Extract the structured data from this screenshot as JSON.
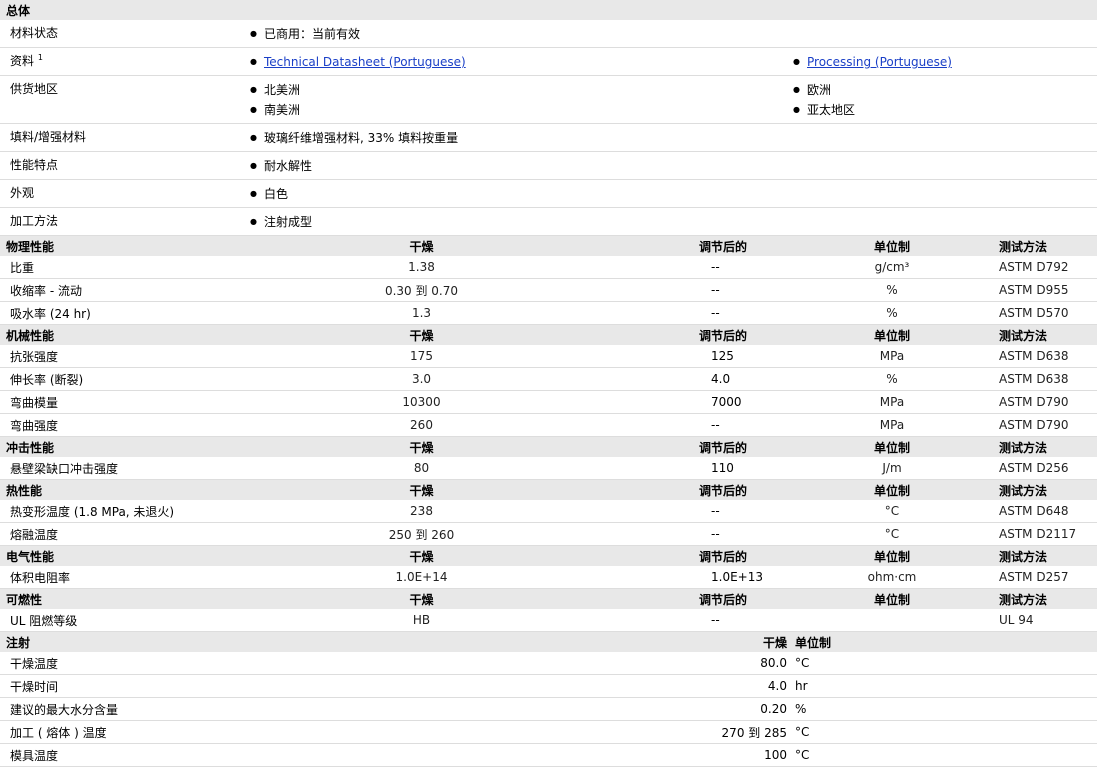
{
  "general": {
    "title": "总体",
    "rows": [
      {
        "label": "材料状态",
        "left": [
          "已商用：当前有效"
        ],
        "right": []
      },
      {
        "label": "资料",
        "sup": "1",
        "left_links": [
          "Technical Datasheet (Portuguese)"
        ],
        "right_links": [
          "Processing (Portuguese)"
        ]
      },
      {
        "label": "供货地区",
        "left": [
          "北美洲",
          "南美洲"
        ],
        "right": [
          "欧洲",
          "亚太地区"
        ]
      },
      {
        "label": "填料/增强材料",
        "left": [
          "玻璃纤维增强材料, 33% 填料按重量"
        ],
        "right": []
      },
      {
        "label": "性能特点",
        "left": [
          "耐水解性"
        ],
        "right": []
      },
      {
        "label": "外观",
        "left": [
          "白色"
        ],
        "right": []
      },
      {
        "label": "加工方法",
        "left": [
          "注射成型"
        ],
        "right": []
      }
    ]
  },
  "columns": {
    "dry": "干燥",
    "conditioned": "调节后的",
    "unit": "单位制",
    "method": "测试方法"
  },
  "sections": [
    {
      "title": "物理性能",
      "rows": [
        {
          "label": "比重",
          "dry": "1.38",
          "cond": "--",
          "unit": "g/cm³",
          "method": "ASTM D792"
        },
        {
          "label": "收缩率 - 流动",
          "dry": "0.30 到  0.70",
          "cond": "--",
          "unit": "%",
          "method": "ASTM D955"
        },
        {
          "label": "吸水率 (24 hr)",
          "dry": "1.3",
          "cond": "--",
          "unit": "%",
          "method": "ASTM D570"
        }
      ]
    },
    {
      "title": "机械性能",
      "rows": [
        {
          "label": "抗张强度",
          "dry": "175",
          "cond": "125",
          "unit": "MPa",
          "method": "ASTM D638"
        },
        {
          "label": "伸长率 (断裂)",
          "dry": "3.0",
          "cond": "4.0",
          "unit": "%",
          "method": "ASTM D638"
        },
        {
          "label": "弯曲模量",
          "dry": "10300",
          "cond": "7000",
          "unit": "MPa",
          "method": "ASTM D790"
        },
        {
          "label": "弯曲强度",
          "dry": "260",
          "cond": "--",
          "unit": "MPa",
          "method": "ASTM D790"
        }
      ]
    },
    {
      "title": "冲击性能",
      "rows": [
        {
          "label": "悬壁梁缺口冲击强度",
          "dry": "80",
          "cond": "110",
          "unit": "J/m",
          "method": "ASTM D256"
        }
      ]
    },
    {
      "title": "热性能",
      "rows": [
        {
          "label": "热变形温度 (1.8 MPa, 未退火)",
          "dry": "238",
          "cond": "--",
          "unit": "°C",
          "method": "ASTM D648"
        },
        {
          "label": "熔融温度",
          "dry": "250 到  260",
          "cond": "--",
          "unit": "°C",
          "method": "ASTM D2117"
        }
      ]
    },
    {
      "title": "电气性能",
      "rows": [
        {
          "label": "体积电阻率",
          "dry": "1.0E+14",
          "cond": "1.0E+13",
          "unit": "ohm·cm",
          "method": "ASTM D257"
        }
      ]
    },
    {
      "title": "可燃性",
      "rows": [
        {
          "label": "UL 阻燃等级",
          "dry": "HB",
          "cond": "--",
          "unit": "",
          "method": "UL 94"
        }
      ]
    }
  ],
  "injection": {
    "title": "注射",
    "col_dry": "干燥",
    "col_unit": "单位制",
    "rows": [
      {
        "label": "干燥温度",
        "value": "80.0",
        "unit": "°C"
      },
      {
        "label": "干燥时间",
        "value": "4.0",
        "unit": "hr"
      },
      {
        "label": "建议的最大水分含量",
        "value": "0.20",
        "unit": "%"
      },
      {
        "label": "加工 ( 熔体 ) 温度",
        "value": "270 到  285",
        "unit": "°C"
      },
      {
        "label": "模具温度",
        "value": "100",
        "unit": "°C"
      }
    ]
  }
}
